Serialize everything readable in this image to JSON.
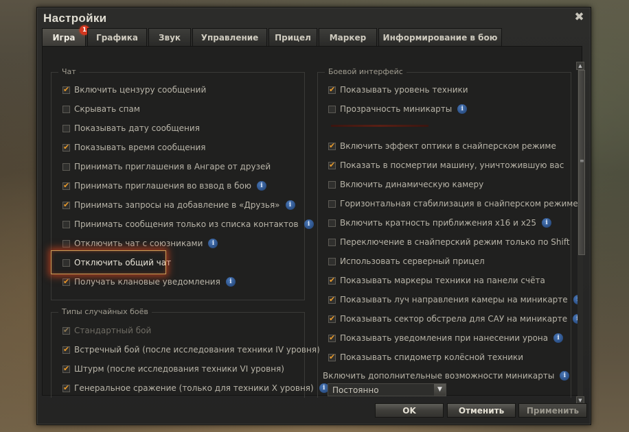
{
  "window": {
    "title": "Настройки",
    "close_glyph": "✖"
  },
  "tabs": [
    {
      "label": "Игра",
      "active": true,
      "badge": "1"
    },
    {
      "label": "Графика"
    },
    {
      "label": "Звук"
    },
    {
      "label": "Управление"
    },
    {
      "label": "Прицел"
    },
    {
      "label": "Маркер"
    },
    {
      "label": "Информирование в бою"
    }
  ],
  "chat": {
    "title": "Чат",
    "items": [
      {
        "label": "Включить цензуру сообщений",
        "checked": true,
        "info": false
      },
      {
        "label": "Скрывать спам",
        "checked": false,
        "info": false
      },
      {
        "label": "Показывать дату сообщения",
        "checked": false,
        "info": false
      },
      {
        "label": "Показывать время сообщения",
        "checked": true,
        "info": false
      },
      {
        "label": "Принимать приглашения в Ангаре от друзей",
        "checked": false,
        "info": false
      },
      {
        "label": "Принимать приглашения во взвод в бою",
        "checked": true,
        "info": true
      },
      {
        "label": "Принимать запросы на добавление в «Друзья»",
        "checked": true,
        "info": true
      },
      {
        "label": "Принимать сообщения только из списка контактов",
        "checked": false,
        "info": true
      },
      {
        "label": "Отключить чат с союзниками",
        "checked": false,
        "info": true
      },
      {
        "label": "Отключить общий чат",
        "checked": false,
        "info": false
      },
      {
        "label": "Получать клановые уведомления",
        "checked": true,
        "info": true
      }
    ]
  },
  "battle_types": {
    "title": "Типы случайных боёв",
    "items": [
      {
        "label": "Стандартный бой",
        "checked": true,
        "disabled": true,
        "info": false
      },
      {
        "label": "Встречный бой (после исследования техники IV уровня)",
        "checked": true,
        "info": false
      },
      {
        "label": "Штурм (после исследования техники VI уровня)",
        "checked": true,
        "info": false
      },
      {
        "label": "Генеральное сражение (только для техники X уровня)",
        "checked": true,
        "info": true
      }
    ]
  },
  "battle_interface": {
    "title": "Боевой интерфейс",
    "items": [
      {
        "label": "Показывать уровень техники",
        "checked": true,
        "info": false
      },
      {
        "label": "Прозрачность миникарты",
        "checked": false,
        "info": true
      },
      {
        "label": "Включить эффект оптики в снайперском режиме",
        "checked": true,
        "info": false
      },
      {
        "label": "Показать в посмертии машину, уничтожившую вас",
        "checked": true,
        "info": false
      },
      {
        "label": "Включить динамическую камеру",
        "checked": false,
        "info": false
      },
      {
        "label": "Горизонтальная стабилизация в снайперском режиме",
        "checked": false,
        "info": false
      },
      {
        "label": "Включить кратность приближения x16 и x25",
        "checked": false,
        "info": true
      },
      {
        "label": "Переключение в снайперский режим только по Shift",
        "checked": false,
        "info": false
      },
      {
        "label": "Использовать серверный прицел",
        "checked": false,
        "info": false
      },
      {
        "label": "Показывать маркеры техники на панели счёта",
        "checked": true,
        "info": false
      },
      {
        "label": "Показывать луч направления камеры на миникарте",
        "checked": true,
        "info": true
      },
      {
        "label": "Показывать сектор обстрела для САУ на миникарте",
        "checked": true,
        "info": true
      },
      {
        "label": "Показывать уведомления при нанесении урона",
        "checked": true,
        "info": true
      },
      {
        "label": "Показывать спидометр колёсной техники",
        "checked": true,
        "info": false
      }
    ],
    "minimap_extra_label": "Включить дополнительные возможности миникарты",
    "minimap_extra_value": "Постоянно"
  },
  "footer": {
    "ok": "OK",
    "cancel": "Отменить",
    "apply": "Применить"
  },
  "icons": {
    "info": "info-icon",
    "checkmark": "checkmark-icon",
    "close": "close-icon",
    "dropdown": "chevron-down-icon"
  },
  "colors": {
    "accent": "#e89a2c",
    "highlight": "#d2461e",
    "badge": "#d3371f",
    "info": "#3f6aa8"
  }
}
